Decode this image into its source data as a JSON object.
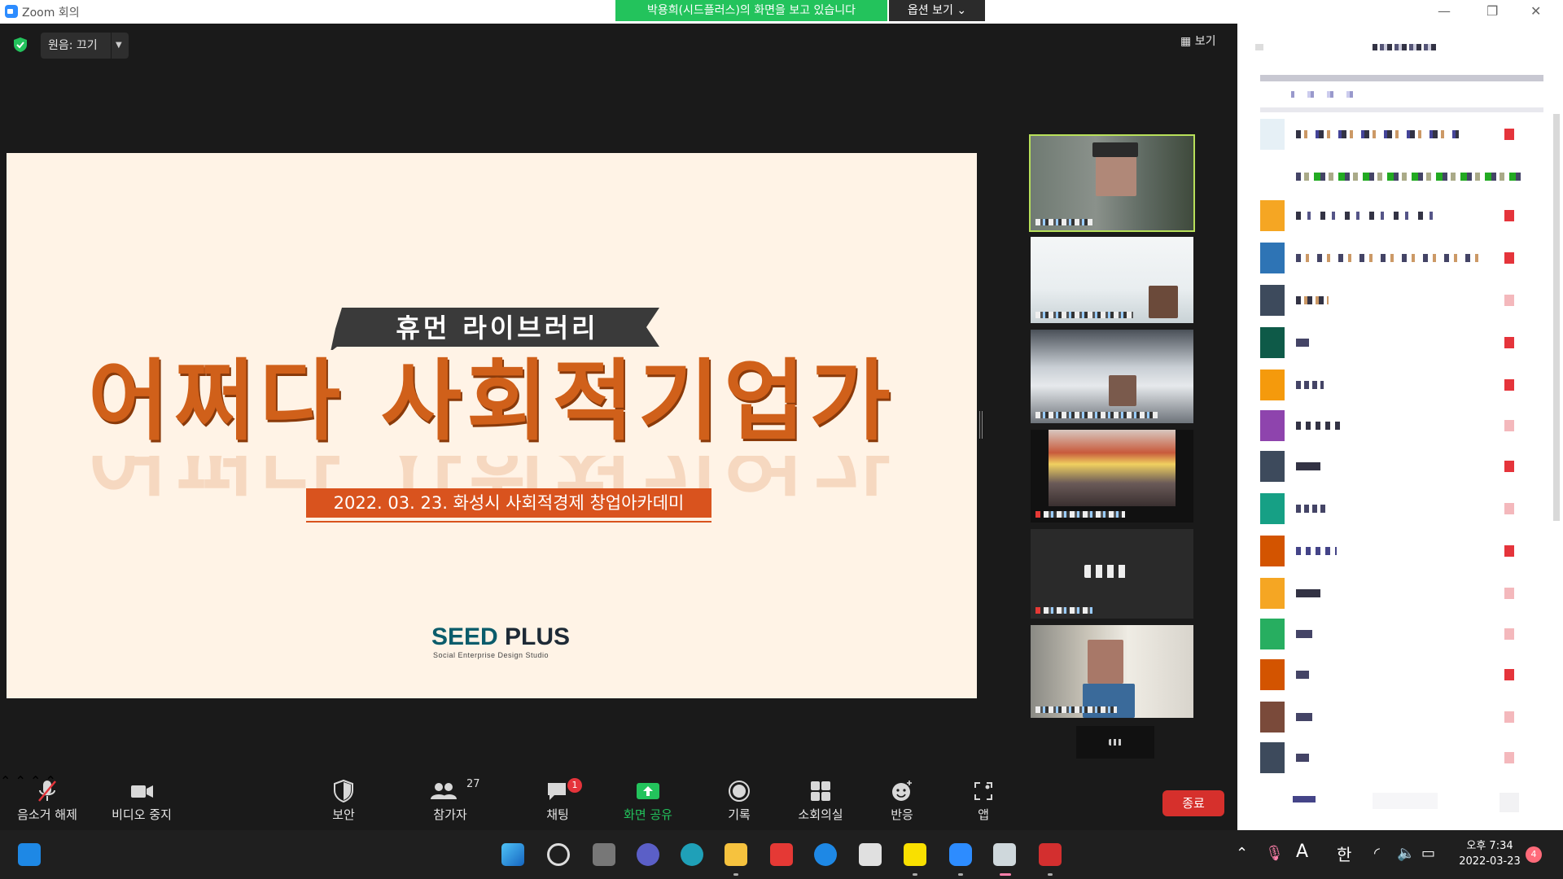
{
  "window": {
    "title": "Zoom 회의"
  },
  "share_banner": {
    "text": "박용희(시드플러스)의 화면을 보고 있습니다",
    "options_label": "옵션 보기"
  },
  "audio": {
    "label": "원음: 끄기"
  },
  "view": {
    "label": "보기"
  },
  "slide": {
    "ribbon": "휴먼 라이브러리",
    "headline": "어쩌다 사회적기업가",
    "date_line": "2022. 03. 23. 화성시 사회적경제 창업아카데미",
    "logo_main": "SEED",
    "logo_plus": "PLUS",
    "logo_sub": "Social Enterprise Design Studio"
  },
  "toolbar": {
    "mute": "음소거 해제",
    "video": "비디오 중지",
    "security": "보안",
    "participants": "참가자",
    "participants_count": "27",
    "chat": "채팅",
    "chat_badge": "1",
    "share": "화면 공유",
    "record": "기록",
    "breakout": "소회의실",
    "reactions": "반응",
    "apps": "앱",
    "end": "종료"
  },
  "taskbar": {
    "ime": "A",
    "lang": "한",
    "time": "오후 7:34",
    "date": "2022-03-23",
    "notifications": "4"
  },
  "colors": {
    "share_green": "#23c35c",
    "end_red": "#d6302c",
    "slide_orange": "#d9531e",
    "zoom_blue": "#2d8cff"
  },
  "icons": [
    "shield-icon",
    "grid-icon",
    "mic-muted-icon",
    "video-icon",
    "security-icon",
    "participants-icon",
    "chat-icon",
    "share-screen-icon",
    "record-icon",
    "breakout-icon",
    "reaction-icon",
    "apps-icon"
  ]
}
